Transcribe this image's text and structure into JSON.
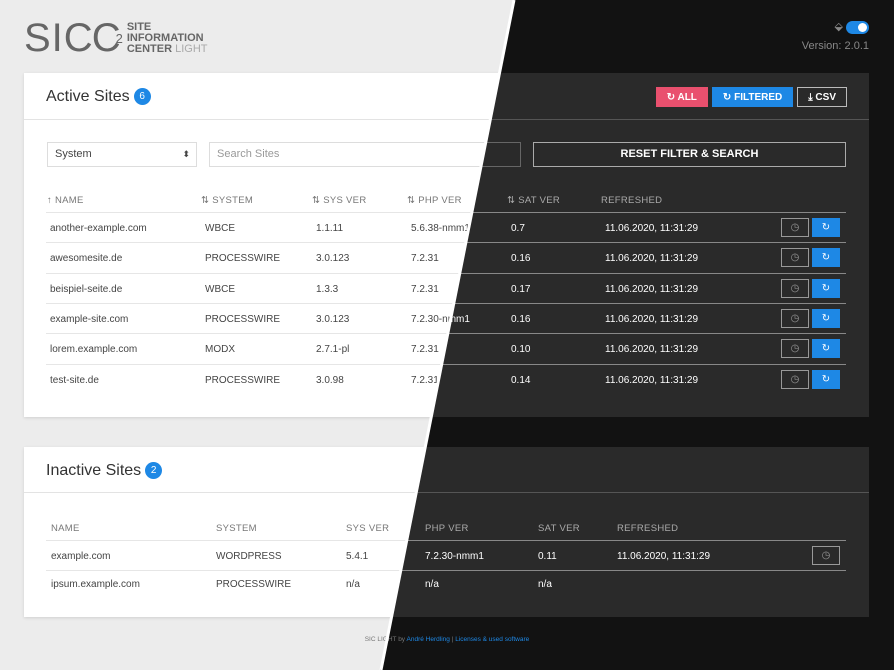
{
  "logo": {
    "main": "SIC",
    "num": "2",
    "line1": "SITE",
    "line2": "INFORMATION",
    "line3": "CENTER",
    "light": "LIGHT"
  },
  "version": "Version: 2.0.1",
  "theme_icon": "paint-bucket-icon",
  "active": {
    "title": "Active Sites",
    "count": "6",
    "buttons": {
      "all": "↻ ALL",
      "filtered": "↻ FILTERED",
      "csv": "⤓ CSV"
    },
    "select_value": "System",
    "search_placeholder": "Search Sites",
    "reset": "RESET FILTER & SEARCH",
    "headers": [
      "↑  NAME",
      "⇅  SYSTEM",
      "⇅  SYS VER",
      "⇅  PHP VER",
      "⇅  SAT VER",
      "REFRESHED"
    ],
    "rows": [
      [
        "another-example.com",
        "WBCE",
        "1.1.11",
        "5.6.38-nmm1",
        "0.7",
        "11.06.2020, 11:31:29"
      ],
      [
        "awesomesite.de",
        "PROCESSWIRE",
        "3.0.123",
        "7.2.31",
        "0.16",
        "11.06.2020, 11:31:29"
      ],
      [
        "beispiel-seite.de",
        "WBCE",
        "1.3.3",
        "7.2.31",
        "0.17",
        "11.06.2020, 11:31:29"
      ],
      [
        "example-site.com",
        "PROCESSWIRE",
        "3.0.123",
        "7.2.30-nmm1",
        "0.16",
        "11.06.2020, 11:31:29"
      ],
      [
        "lorem.example.com",
        "MODX",
        "2.7.1-pl",
        "7.2.31",
        "0.10",
        "11.06.2020, 11:31:29"
      ],
      [
        "test-site.de",
        "PROCESSWIRE",
        "3.0.98",
        "7.2.31",
        "0.14",
        "11.06.2020, 11:31:29"
      ]
    ]
  },
  "inactive": {
    "title": "Inactive Sites",
    "count": "2",
    "headers": [
      "NAME",
      "SYSTEM",
      "SYS VER",
      "PHP VER",
      "SAT VER",
      "REFRESHED"
    ],
    "rows": [
      [
        "example.com",
        "WORDPRESS",
        "5.4.1",
        "7.2.30-nmm1",
        "0.11",
        "11.06.2020, 11:31:29"
      ],
      [
        "ipsum.example.com",
        "PROCESSWIRE",
        "n/a",
        "n/a",
        "n/a",
        ""
      ]
    ]
  },
  "footer": {
    "prefix": "SIC LIGHT by ",
    "author": "André Herdling",
    "sep": " | ",
    "licenses": "Licenses & used software"
  },
  "colors": {
    "accent": "#1e88e5",
    "danger": "#e9506e",
    "dark_bg": "#121212",
    "dark_card": "#2a2a2a"
  }
}
